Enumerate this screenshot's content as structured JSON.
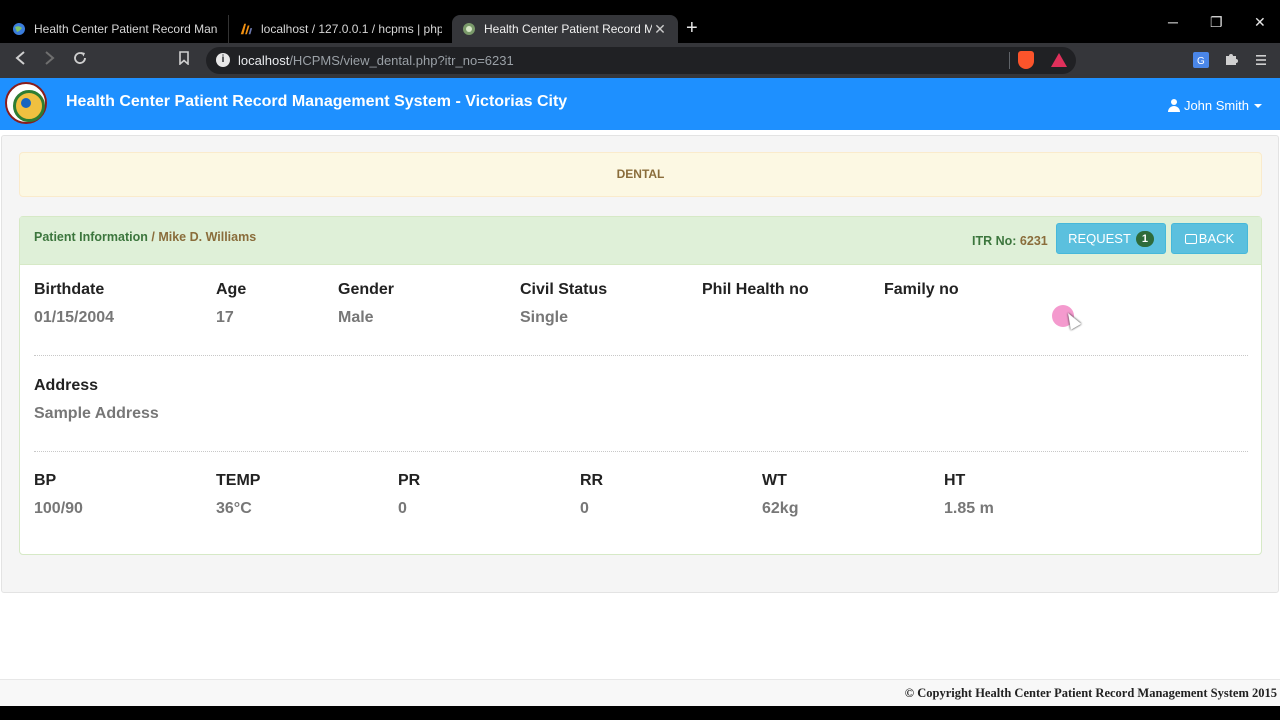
{
  "browser": {
    "tabs": [
      {
        "title": "Health Center Patient Record Management"
      },
      {
        "title": "localhost / 127.0.0.1 / hcpms | phpMyAdmin"
      },
      {
        "title": "Health Center Patient Record Management"
      }
    ],
    "new_tab": "+",
    "close_glyph": "✕",
    "url_host": "localhost",
    "url_path": "/HCPMS/view_dental.php?itr_no=6231",
    "window_controls": [
      "─",
      "❐",
      "✕"
    ]
  },
  "navbar": {
    "brand": "Health Center Patient Record Management System - Victorias City",
    "user": "John Smith"
  },
  "banner": {
    "title": "DENTAL"
  },
  "panel": {
    "crumb_section": "Patient Information",
    "crumb_sep": " / ",
    "patient_name": "Mike D. Williams",
    "itr_label": "ITR No:",
    "itr_value": "6231",
    "request_label": "REQUEST",
    "request_count": "1",
    "back_label": "BACK"
  },
  "info": {
    "birthdate": {
      "label": "Birthdate",
      "value": "01/15/2004"
    },
    "age": {
      "label": "Age",
      "value": "17"
    },
    "gender": {
      "label": "Gender",
      "value": "Male"
    },
    "civil_status": {
      "label": "Civil Status",
      "value": "Single"
    },
    "philhealth": {
      "label": "Phil Health no",
      "value": ""
    },
    "family_no": {
      "label": "Family no",
      "value": ""
    },
    "address": {
      "label": "Address",
      "value": "Sample Address"
    }
  },
  "vitals": {
    "bp": {
      "label": "BP",
      "value": "100/90"
    },
    "temp": {
      "label": "TEMP",
      "value": "36°C"
    },
    "pr": {
      "label": "PR",
      "value": "0"
    },
    "rr": {
      "label": "RR",
      "value": "0"
    },
    "wt": {
      "label": "WT",
      "value": "62kg"
    },
    "ht": {
      "label": "HT",
      "value": "1.85 m"
    }
  },
  "footer": {
    "copyright": "© Copyright Health Center Patient Record Management System 2015"
  },
  "colors": {
    "navbar": "#1e90ff",
    "banner_bg": "#fcf8e3",
    "panel_heading_bg": "#dff0d8",
    "button_info": "#5bc0de"
  }
}
